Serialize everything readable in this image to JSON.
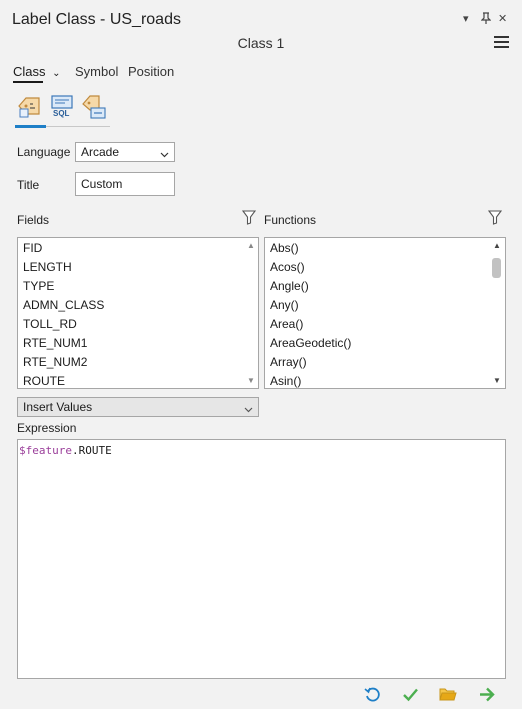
{
  "window": {
    "title": "Label Class - US_roads"
  },
  "class_name": "Class 1",
  "tabs": [
    {
      "label": "Class",
      "active": true
    },
    {
      "label": "Symbol",
      "active": false
    },
    {
      "label": "Position",
      "active": false
    }
  ],
  "mode_icons": [
    {
      "name": "label-class-icon",
      "selected": true
    },
    {
      "name": "sql-query-icon",
      "label": "SQL",
      "selected": false
    },
    {
      "name": "label-placement-icon",
      "selected": false
    }
  ],
  "language": {
    "label": "Language",
    "value": "Arcade"
  },
  "title_field": {
    "label": "Title",
    "value": "Custom"
  },
  "fields": {
    "header": "Fields",
    "items": [
      "FID",
      "LENGTH",
      "TYPE",
      "ADMN_CLASS",
      "TOLL_RD",
      "RTE_NUM1",
      "RTE_NUM2",
      "ROUTE"
    ]
  },
  "functions": {
    "header": "Functions",
    "items": [
      "Abs()",
      "Acos()",
      "Angle()",
      "Any()",
      "Area()",
      "AreaGeodetic()",
      "Array()",
      "Asin()"
    ]
  },
  "insert_values": {
    "label": "Insert Values"
  },
  "expression": {
    "label": "Expression",
    "keyword": "$feature",
    "rest": ".ROUTE"
  },
  "colors": {
    "accent": "#1e7fc7",
    "verify": "#4caf50",
    "folder": "#e6a817",
    "apply": "#4caf50"
  }
}
